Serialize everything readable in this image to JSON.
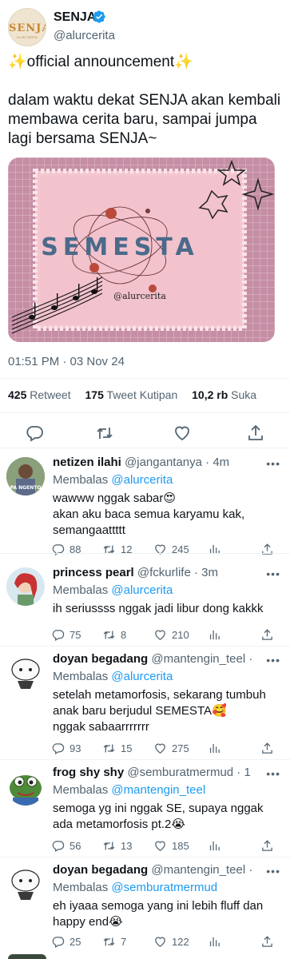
{
  "tweet": {
    "author_name": "SENJA",
    "author_handle": "@alurcerita",
    "avatar_text": "SENJA",
    "avatar_subtext": "ALUR CERITA",
    "text_line1": "✨official announcement✨",
    "text_line2": "dalam waktu dekat SENJA akan kembali membawa cerita baru, sampai jumpa lagi bersama SENJA~",
    "image": {
      "title": "SEMESTA",
      "handle": "@alurcerita"
    },
    "timestamp": "01:51 PM · 03 Nov 24",
    "stats": {
      "retweets_count": "425",
      "retweets_label": "Retweet",
      "quotes_count": "175",
      "quotes_label": "Tweet Kutipan",
      "likes_count": "10,2 rb",
      "likes_label": "Suka"
    },
    "actions": [
      "reply-icon",
      "retweet-icon",
      "like-icon",
      "share-icon"
    ]
  },
  "replies": [
    {
      "name": "netizen ilahi",
      "handle": "@jangantanya",
      "sep": " · ",
      "time": "4m",
      "replying_label": "Membalas",
      "replying_to": "@alurcerita",
      "text": "wawww nggak sabar😍\nakan aku baca semua karyamu kak, semangaattttt",
      "avatar_text": "PA NGENTO",
      "replies": "88",
      "retweets": "12",
      "likes": "245"
    },
    {
      "name": "princess pearl",
      "handle": "@fckurlife",
      "sep": " · ",
      "time": "3m",
      "replying_label": "Membalas",
      "replying_to": "@alurcerita",
      "text": "ih seriussss nggak jadi libur dong kakkk",
      "replies": "75",
      "retweets": "8",
      "likes": "210"
    },
    {
      "name": "doyan begadang",
      "handle": "@mantengin_teel",
      "sep": " ·",
      "time": "",
      "replying_label": "Membalas",
      "replying_to": "@alurcerita",
      "text": "setelah metamorfosis, sekarang tumbuh anak baru berjudul SEMESTA🥰\nnggak sabaarrrrrrr",
      "replies": "93",
      "retweets": "15",
      "likes": "275"
    },
    {
      "name": "frog shy shy",
      "handle": "@semburatmermud",
      "sep": " · ",
      "time": "1",
      "replying_label": "Membalas",
      "replying_to": "@mantengin_teel",
      "text": "semoga yg ini nggak SE, supaya nggak ada metamorfosis pt.2😭",
      "replies": "56",
      "retweets": "13",
      "likes": "185"
    },
    {
      "name": "doyan begadang",
      "handle": "@mantengin_teel",
      "sep": " ·",
      "time": "",
      "replying_label": "Membalas",
      "replying_to": "@semburatmermud",
      "text": "eh iyaaa semoga yang ini lebih fluff dan happy end😭",
      "replies": "25",
      "retweets": "7",
      "likes": "122"
    }
  ],
  "colors": {
    "accent": "#1d9bf0",
    "muted": "#536471",
    "text": "#0f1419",
    "pink": "#c890a6",
    "pink_light": "#f3c4cf"
  }
}
